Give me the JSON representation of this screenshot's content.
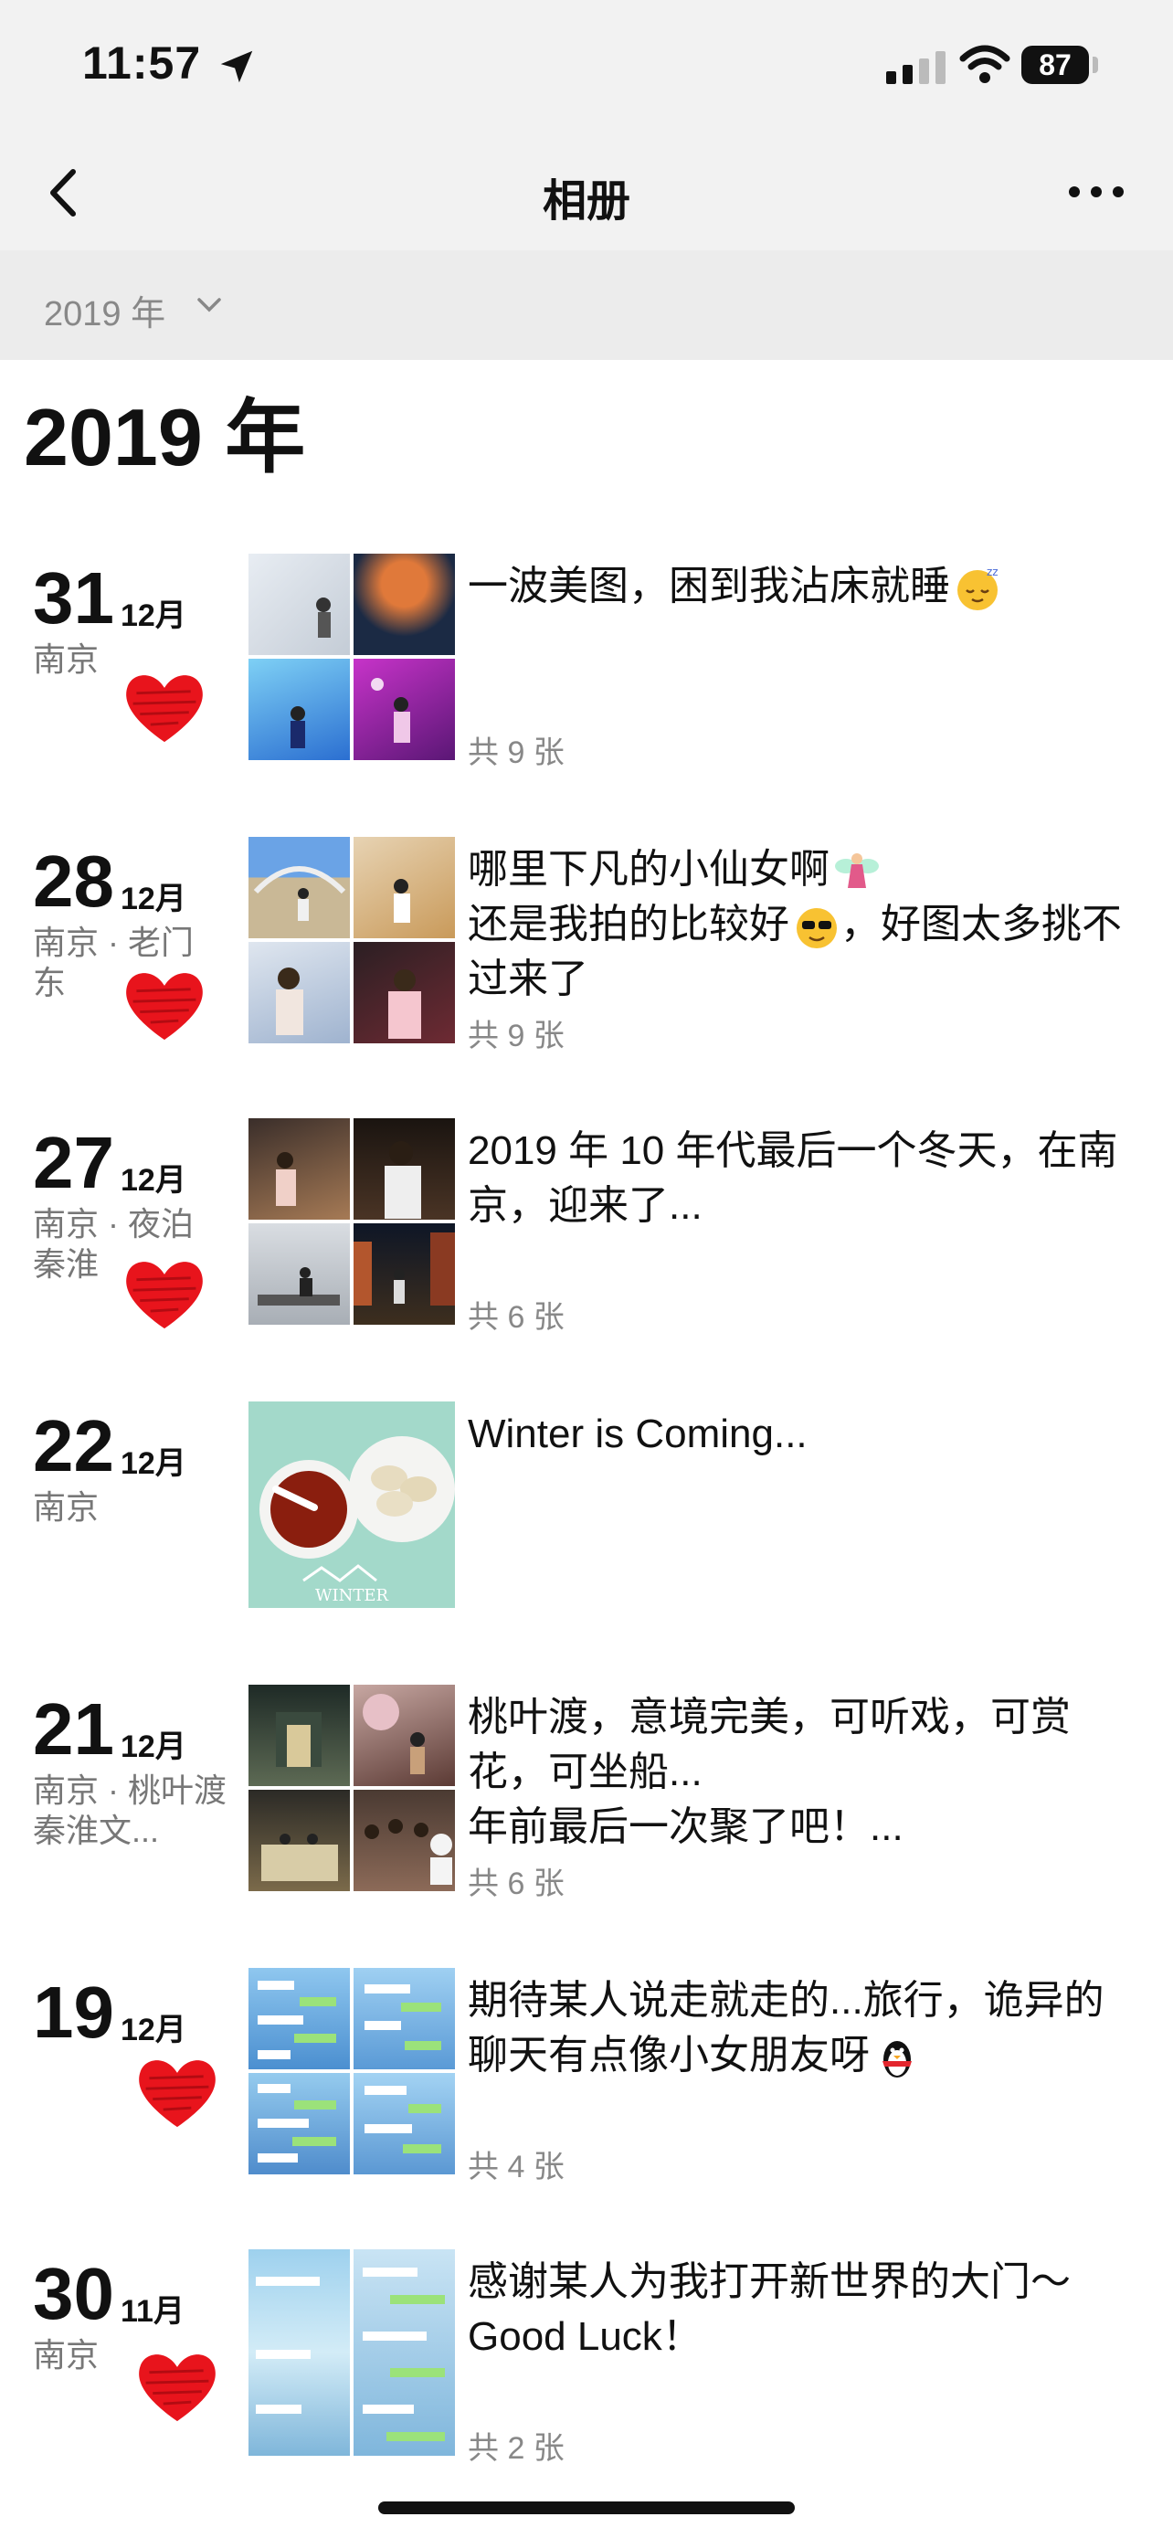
{
  "status_bar": {
    "time": "11:57",
    "battery": "87"
  },
  "nav": {
    "title": "相册"
  },
  "filter": {
    "label": "2019 年"
  },
  "year_heading": "2019 年",
  "posts": [
    {
      "day": "31",
      "month": "12月",
      "place": "南京",
      "caption": "一波美图，困到我沾床就睡",
      "emoji": "sleepy-face-emoji",
      "count": "共 9 张"
    },
    {
      "day": "28",
      "month": "12月",
      "place": "南京 · 老门东",
      "caption_lines": [
        "哪里下凡的小仙女啊",
        "还是我拍的比较好",
        "，好图太多挑不过来了"
      ],
      "count": "共 9 张"
    },
    {
      "day": "27",
      "month": "12月",
      "place": "南京 · 夜泊秦淮",
      "caption": "2019 年 10 年代最后一个冬天，在南京，迎来了...",
      "count": "共 6 张"
    },
    {
      "day": "22",
      "month": "12月",
      "place": "南京",
      "caption": "Winter is Coming...",
      "thumb_label": "WINTER"
    },
    {
      "day": "21",
      "month": "12月",
      "place": "南京 · 桃叶渡秦淮文...",
      "caption": "桃叶渡，意境完美，可听戏，可赏花，可坐船...",
      "caption2": "年前最后一次聚了吧！...",
      "count": "共 6 张"
    },
    {
      "day": "19",
      "month": "12月",
      "place": "",
      "caption": "期待某人说走就走的...旅行，诡异的聊天有点像小女朋友呀",
      "count": "共 4 张"
    },
    {
      "day": "30",
      "month": "11月",
      "place": "南京",
      "caption": "感谢某人为我打开新世界的大门～Good Luck！",
      "count": "共 2 张"
    }
  ],
  "colors": {
    "heart": "#e8141c",
    "page_bg": "#ffffff",
    "header_bg": "#f2f2f2",
    "muted_text": "#888888"
  }
}
